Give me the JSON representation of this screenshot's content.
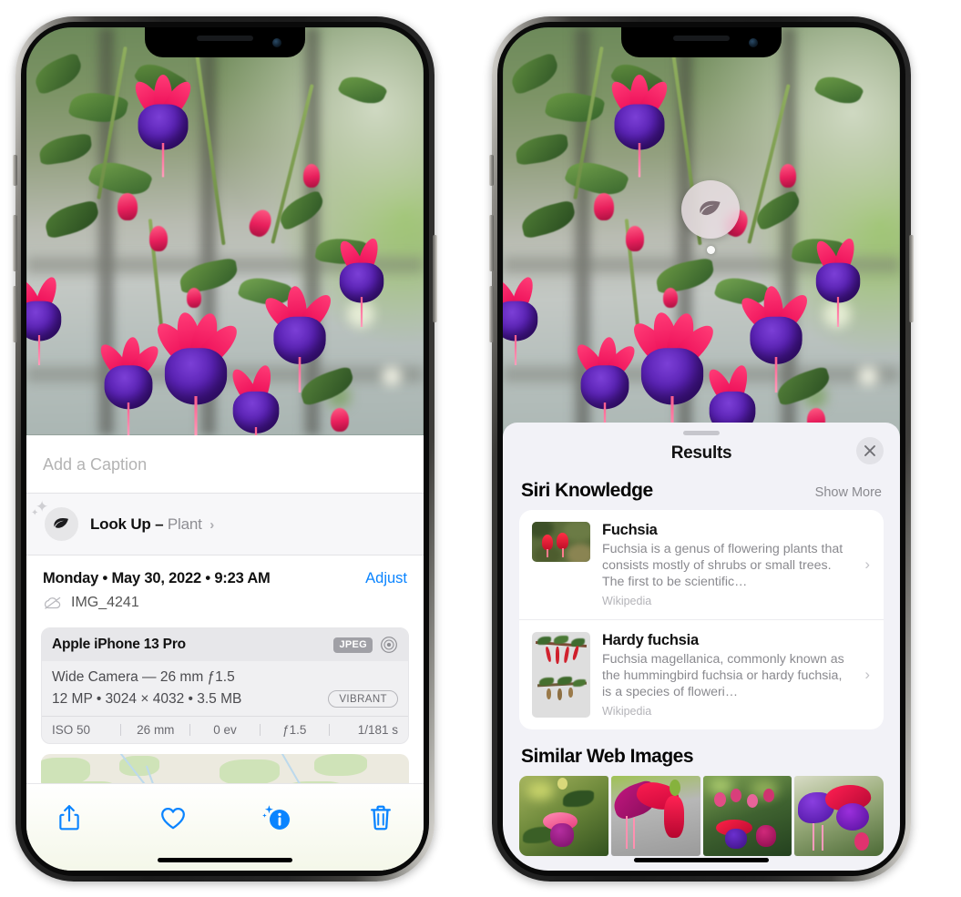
{
  "left_phone": {
    "caption_placeholder": "Add a Caption",
    "lookup": {
      "label": "Look Up –",
      "subject": "Plant",
      "icon": "leaf-icon",
      "chevron": "›"
    },
    "metadata": {
      "date": "Monday • May 30, 2022 • 9:23 AM",
      "adjust_label": "Adjust",
      "filename": "IMG_4241",
      "cloud_icon": "icloud-slash-icon"
    },
    "camera_card": {
      "model": "Apple iPhone 13 Pro",
      "format_badge": "JPEG",
      "aperture_icon": "aperture-icon",
      "lens": "Wide Camera — 26 mm ƒ1.5",
      "specs": "12 MP • 3024 × 4032 • 3.5 MB",
      "style_badge": "VIBRANT",
      "exif": [
        "ISO 50",
        "26 mm",
        "0 ev",
        "ƒ1.5",
        "1/181 s"
      ]
    },
    "toolbar": {
      "share_label": "share-icon",
      "favorite_label": "heart-icon",
      "info_label": "info-sparkle-icon",
      "delete_label": "trash-icon"
    }
  },
  "right_phone": {
    "visual_lookup_badge_icon": "leaf-icon",
    "sheet": {
      "title": "Results",
      "close_icon": "close-icon"
    },
    "siri_knowledge": {
      "heading": "Siri Knowledge",
      "show_more": "Show More",
      "cards": [
        {
          "title": "Fuchsia",
          "description": "Fuchsia is a genus of flowering plants that consists mostly of shrubs or small trees. The first to be scientific…",
          "source": "Wikipedia",
          "chevron": "›"
        },
        {
          "title": "Hardy fuchsia",
          "description": "Fuchsia magellanica, commonly known as the hummingbird fuchsia or hardy fuchsia, is a species of floweri…",
          "source": "Wikipedia",
          "chevron": "›"
        }
      ]
    },
    "similar_web_images": {
      "heading": "Similar Web Images",
      "count": 4
    }
  },
  "colors": {
    "accent_blue": "#0a84ff",
    "sheet_bg": "#f2f2f7",
    "card_bg": "#ffffff",
    "secondary_text": "#8a8a8f"
  }
}
